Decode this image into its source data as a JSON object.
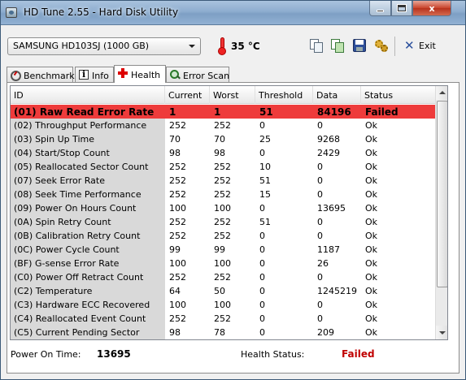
{
  "window": {
    "title": "HD Tune 2.55 - Hard Disk Utility",
    "controls": {
      "minimize": "",
      "maximize": "",
      "close": "x"
    }
  },
  "toolbar": {
    "drive": "SAMSUNG HD103SJ (1000 GB)",
    "temperature": "35 °C",
    "exit_label": "Exit",
    "icons": [
      "copy-icon",
      "copy-all-icon",
      "save-icon",
      "options-icon",
      "exit-icon"
    ]
  },
  "tabs": [
    {
      "label": "Benchmark",
      "icon": "gauge-icon"
    },
    {
      "label": "Info",
      "icon": "info-icon"
    },
    {
      "label": "Health",
      "icon": "health-cross-icon",
      "active": true
    },
    {
      "label": "Error Scan",
      "icon": "magnifier-icon"
    }
  ],
  "table": {
    "columns": [
      "ID",
      "Current",
      "Worst",
      "Threshold",
      "Data",
      "Status"
    ],
    "rows": [
      {
        "id": "(01) Raw Read Error Rate",
        "current": "1",
        "worst": "1",
        "threshold": "51",
        "data": "84196",
        "status": "Failed"
      },
      {
        "id": "(02) Throughput Performance",
        "current": "252",
        "worst": "252",
        "threshold": "0",
        "data": "0",
        "status": "Ok"
      },
      {
        "id": "(03) Spin Up Time",
        "current": "70",
        "worst": "70",
        "threshold": "25",
        "data": "9268",
        "status": "Ok"
      },
      {
        "id": "(04) Start/Stop Count",
        "current": "98",
        "worst": "98",
        "threshold": "0",
        "data": "2429",
        "status": "Ok"
      },
      {
        "id": "(05) Reallocated Sector Count",
        "current": "252",
        "worst": "252",
        "threshold": "10",
        "data": "0",
        "status": "Ok"
      },
      {
        "id": "(07) Seek Error Rate",
        "current": "252",
        "worst": "252",
        "threshold": "51",
        "data": "0",
        "status": "Ok"
      },
      {
        "id": "(08) Seek Time Performance",
        "current": "252",
        "worst": "252",
        "threshold": "15",
        "data": "0",
        "status": "Ok"
      },
      {
        "id": "(09) Power On Hours Count",
        "current": "100",
        "worst": "100",
        "threshold": "0",
        "data": "13695",
        "status": "Ok"
      },
      {
        "id": "(0A) Spin Retry Count",
        "current": "252",
        "worst": "252",
        "threshold": "51",
        "data": "0",
        "status": "Ok"
      },
      {
        "id": "(0B) Calibration Retry Count",
        "current": "252",
        "worst": "252",
        "threshold": "0",
        "data": "0",
        "status": "Ok"
      },
      {
        "id": "(0C) Power Cycle Count",
        "current": "99",
        "worst": "99",
        "threshold": "0",
        "data": "1187",
        "status": "Ok"
      },
      {
        "id": "(BF) G-sense Error Rate",
        "current": "100",
        "worst": "100",
        "threshold": "0",
        "data": "26",
        "status": "Ok"
      },
      {
        "id": "(C0) Power Off Retract Count",
        "current": "252",
        "worst": "252",
        "threshold": "0",
        "data": "0",
        "status": "Ok"
      },
      {
        "id": "(C2) Temperature",
        "current": "64",
        "worst": "50",
        "threshold": "0",
        "data": "1245219",
        "status": "Ok"
      },
      {
        "id": "(C3) Hardware ECC Recovered",
        "current": "100",
        "worst": "100",
        "threshold": "0",
        "data": "0",
        "status": "Ok"
      },
      {
        "id": "(C4) Reallocated Event Count",
        "current": "252",
        "worst": "252",
        "threshold": "0",
        "data": "0",
        "status": "Ok"
      },
      {
        "id": "(C5) Current Pending Sector",
        "current": "98",
        "worst": "78",
        "threshold": "0",
        "data": "209",
        "status": "Ok"
      }
    ]
  },
  "status": {
    "power_on_label": "Power On Time:",
    "power_on_value": "13695",
    "health_label": "Health Status:",
    "health_value": "Failed"
  },
  "colors": {
    "failed_row": "#ee3b3b",
    "failed_text": "#c00000",
    "id_column_bg": "#d9d9d9"
  }
}
